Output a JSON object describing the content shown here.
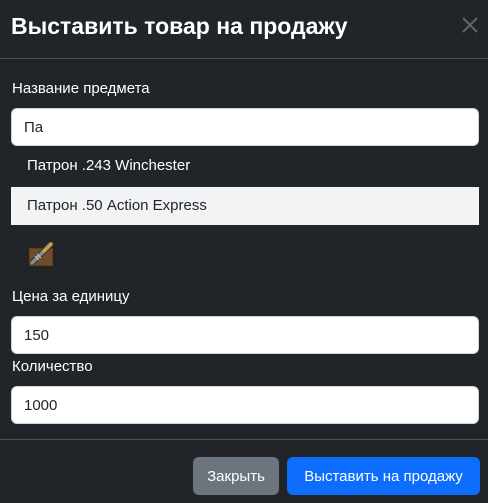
{
  "dialog": {
    "title": "Выставить товар на продажу",
    "close_icon": "close-icon"
  },
  "form": {
    "item_name": {
      "label": "Название предмета",
      "value": "Па"
    },
    "suggestions": [
      {
        "label": "Патрон .243 Winchester",
        "highlighted": false
      },
      {
        "label": "Патрон .50 Action Express",
        "highlighted": true
      }
    ],
    "item_icon": "ammo-box-icon",
    "price": {
      "label": "Цена за единицу",
      "value": "150"
    },
    "quantity": {
      "label": "Количество",
      "value": "1000"
    }
  },
  "footer": {
    "close_label": "Закрыть",
    "submit_label": "Выставить на продажу"
  },
  "colors": {
    "background": "#212529",
    "input_background": "#ffffff",
    "suggestion_highlight": "#f1f3f5",
    "secondary_button": "#6c757d",
    "primary_button": "#0d6efd",
    "divider": "#495057"
  }
}
